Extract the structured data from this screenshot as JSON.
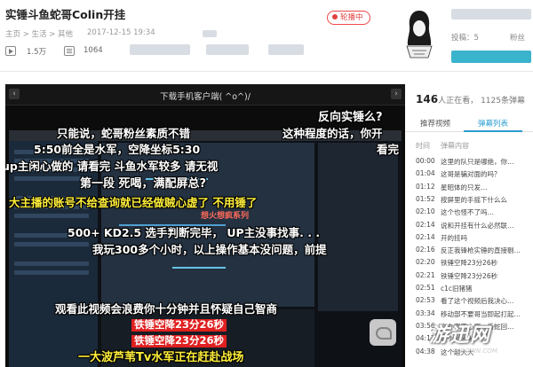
{
  "header": {
    "title": "实锤斗鱼蛇哥Colin开挂",
    "badge": "轮播中",
    "breadcrumb": "主页 > 生活 > 其他",
    "date": "2017-12-15 19:34",
    "views": "1.5万",
    "danmaku_count": "1064"
  },
  "uploader": {
    "stats": [
      "投稿：5",
      "粉丝"
    ]
  },
  "player": {
    "top_title": "下载手机客户端( ^o^)/",
    "screen_banner": "想火想疯系列",
    "danmaku": [
      "反向实锤么?",
      "只能说，蛇哥粉丝素质不错",
      "这种程度的话，你开",
      "5:50前全是水军，空降坐标5:30",
      "看完",
      "up主闲心做的 请看完 斗鱼水军较多 请无视",
      "第一段 死喝，满配屏总?",
      "大主播的账号不给查询就已经做贼心虚了 不用锤了",
      "500+ KD2.5 选手判断完毕， UP主没事找事. . .",
      "我玩300多个小时，以上操作基本没问题，前提",
      "观看此视频会浪费你十分钟并且怀疑自己智商",
      "铁锤空降23分26秒",
      "铁锤空降23分26秒",
      "一大波芦苇Tv水军正在赶赴战场"
    ]
  },
  "watermark": {
    "brand": "游迅网",
    "domain": "YXDOWN.COM"
  },
  "sidebar": {
    "online": "146",
    "online_label": "人正在看，",
    "danmaku_total": "1125条弹幕",
    "tabs": [
      "推荐视频",
      "弹幕列表"
    ],
    "columns": [
      "时间",
      "弹幕内容"
    ],
    "rows": [
      [
        "00:00",
        "这里的队只是哪绝，你…"
      ],
      [
        "01:04",
        "这哥是骗对面的吗？"
      ],
      [
        "01:12",
        "星昭体的只发…"
      ],
      [
        "01:52",
        "按屏里的手摇下什么么"
      ],
      [
        "02:10",
        "这个也怪不了吗…"
      ],
      [
        "02:14",
        "说和开挂有什么必然联…"
      ],
      [
        "02:14",
        "开的挂吗"
      ],
      [
        "02:16",
        "反正我锋枪实锤的直接剔…"
      ],
      [
        "02:20",
        "铁锤空降23分26秒"
      ],
      [
        "02:21",
        "铁锤空降23分26秒"
      ],
      [
        "02:51",
        "c1c旧猪猪"
      ],
      [
        "02:53",
        "看了这个视频后我决心…"
      ],
      [
        "03:34",
        "移动部不要哥当即起打起…"
      ],
      [
        "03:56",
        "你办事不心哪一番蛇回…"
      ],
      [
        "04:17",
        "这个越大大"
      ],
      [
        "04:38",
        "这个越大大"
      ]
    ]
  },
  "colors": {
    "accent": "#2a9dd0",
    "badge": "#e24040",
    "danmaku_yellow": "#ffef3a",
    "danmaku_red": "#ff3030"
  }
}
